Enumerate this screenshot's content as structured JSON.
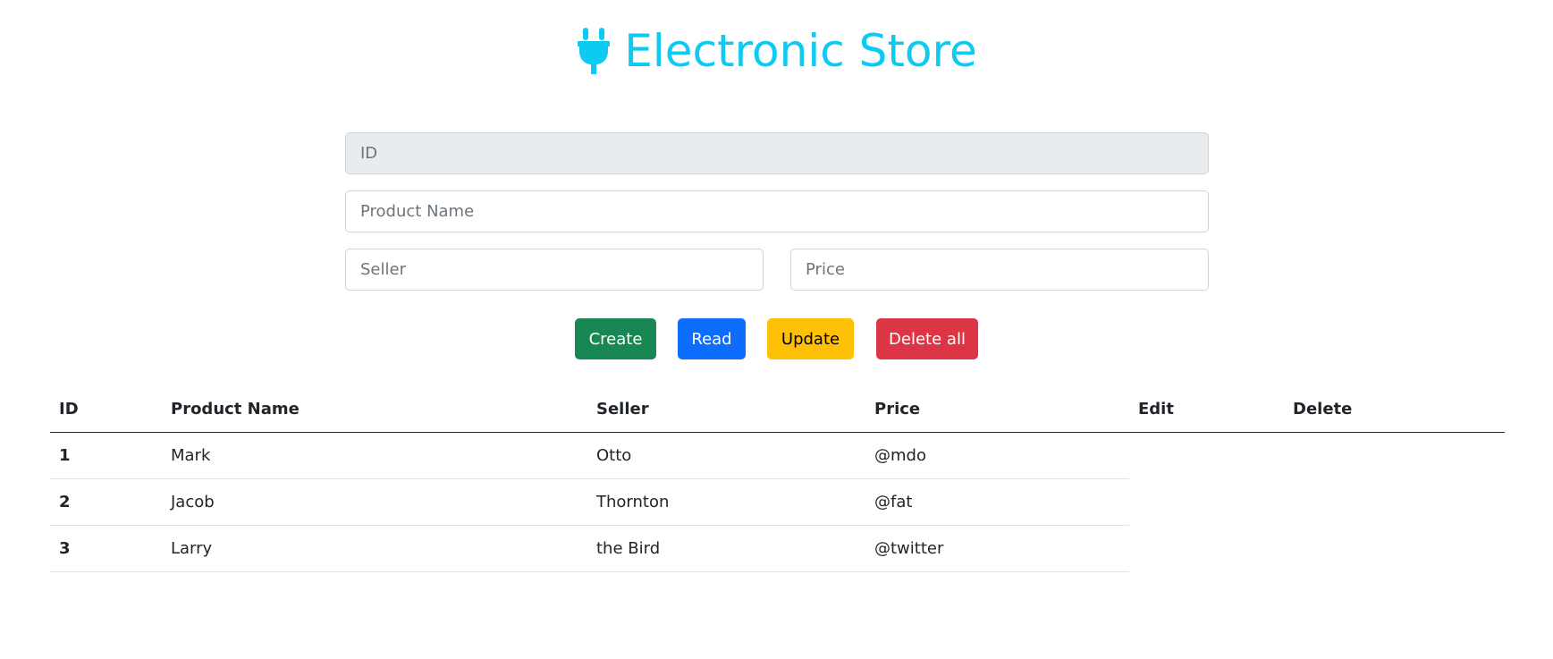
{
  "header": {
    "title": "Electronic Store",
    "icon": "plug-icon",
    "color": "#0dcaf0"
  },
  "form": {
    "id_placeholder": "ID",
    "product_name_placeholder": "Product Name",
    "seller_placeholder": "Seller",
    "price_placeholder": "Price"
  },
  "buttons": {
    "create": "Create",
    "read": "Read",
    "update": "Update",
    "delete_all": "Delete all"
  },
  "table": {
    "headers": [
      "ID",
      "Product Name",
      "Seller",
      "Price",
      "Edit",
      "Delete"
    ],
    "rows": [
      {
        "id": "1",
        "name": "Mark",
        "seller": "Otto",
        "price": "@mdo"
      },
      {
        "id": "2",
        "name": "Jacob",
        "seller": "Thornton",
        "price": "@fat"
      },
      {
        "id": "3",
        "name": "Larry",
        "seller": "the Bird",
        "price": "@twitter"
      }
    ]
  }
}
